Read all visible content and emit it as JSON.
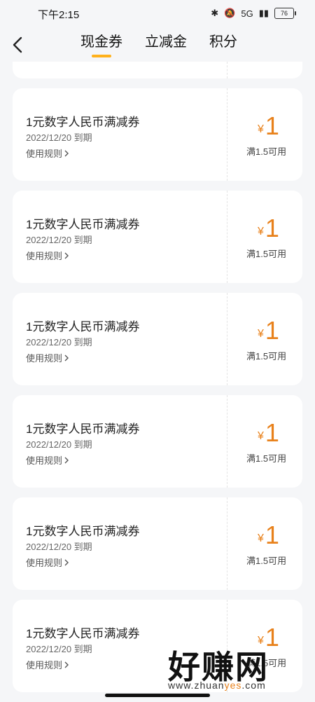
{
  "status": {
    "time": "下午2:15",
    "network": "5G",
    "battery": "76"
  },
  "header": {
    "tabs": [
      {
        "label": "现金券",
        "active": true
      },
      {
        "label": "立减金",
        "active": false
      },
      {
        "label": "积分",
        "active": false
      }
    ]
  },
  "coupons": [
    {
      "title": "1元数字人民币满减券",
      "date": "2022/12/20 到期",
      "rules": "使用规则",
      "currency": "¥",
      "amount": "1",
      "condition": "满1.5可用"
    },
    {
      "title": "1元数字人民币满减券",
      "date": "2022/12/20 到期",
      "rules": "使用规则",
      "currency": "¥",
      "amount": "1",
      "condition": "满1.5可用"
    },
    {
      "title": "1元数字人民币满减券",
      "date": "2022/12/20 到期",
      "rules": "使用规则",
      "currency": "¥",
      "amount": "1",
      "condition": "满1.5可用"
    },
    {
      "title": "1元数字人民币满减券",
      "date": "2022/12/20 到期",
      "rules": "使用规则",
      "currency": "¥",
      "amount": "1",
      "condition": "满1.5可用"
    },
    {
      "title": "1元数字人民币满减券",
      "date": "2022/12/20 到期",
      "rules": "使用规则",
      "currency": "¥",
      "amount": "1",
      "condition": "满1.5可用"
    },
    {
      "title": "1元数字人民币满减券",
      "date": "2022/12/20 到期",
      "rules": "使用规则",
      "currency": "¥",
      "amount": "1",
      "condition": "满1.5可用"
    }
  ],
  "watermark": {
    "big": "好赚网",
    "small_pre": "www.zhuan",
    "small_ye": "yes",
    "small_post": ".com"
  },
  "colors": {
    "accent": "#ffb11b",
    "amount": "#e8811b",
    "background": "#f5f6f8"
  }
}
